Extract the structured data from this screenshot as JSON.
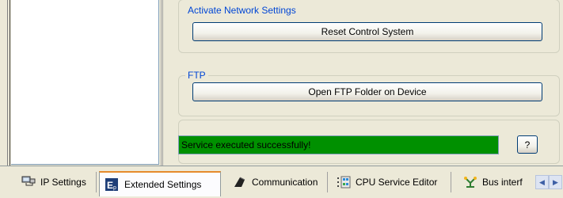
{
  "groups": {
    "activate": {
      "title": "Activate Network Settings",
      "button": "Reset Control System"
    },
    "ftp": {
      "title": "FTP",
      "button": "Open FTP Folder on Device"
    }
  },
  "status": {
    "message": "Service executed successfully!",
    "color": "#009000",
    "help_label": "?"
  },
  "tabs": [
    {
      "label": "IP Settings",
      "icon": "network-icon",
      "active": false
    },
    {
      "label": "Extended Settings",
      "icon": "extended-settings-icon",
      "active": true
    },
    {
      "label": "Communication",
      "icon": "communication-icon",
      "active": false
    },
    {
      "label": "CPU Service Editor",
      "icon": "cpu-service-icon",
      "active": false
    },
    {
      "label": "Bus interf",
      "icon": "bus-interface-icon",
      "active": false
    }
  ],
  "colors": {
    "accent": "#0046d5",
    "active_tab_top": "#e68b2c"
  }
}
